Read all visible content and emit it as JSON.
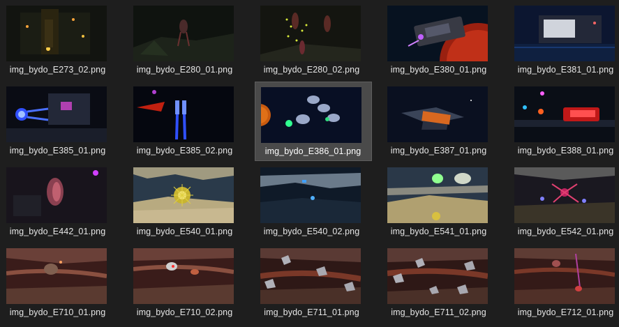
{
  "selected_file": "img_bydo_E386_01.png",
  "files": [
    {
      "name": "img_bydo_E273_02.png",
      "scene": "dark-hive"
    },
    {
      "name": "img_bydo_E280_01.png",
      "scene": "jungle-dark"
    },
    {
      "name": "img_bydo_E280_02.png",
      "scene": "jungle-lights"
    },
    {
      "name": "img_bydo_E380_01.png",
      "scene": "space-ship-planet"
    },
    {
      "name": "img_bydo_E381_01.png",
      "scene": "blue-station"
    },
    {
      "name": "img_bydo_E385_01.png",
      "scene": "station-blue-thrust"
    },
    {
      "name": "img_bydo_E385_02.png",
      "scene": "space-blue-thrust"
    },
    {
      "name": "img_bydo_E386_01.png",
      "scene": "space-pods"
    },
    {
      "name": "img_bydo_E387_01.png",
      "scene": "orange-block"
    },
    {
      "name": "img_bydo_E388_01.png",
      "scene": "red-fighter"
    },
    {
      "name": "img_bydo_E442_01.png",
      "scene": "organic-cave"
    },
    {
      "name": "img_bydo_E540_01.png",
      "scene": "sand-cave-urchin"
    },
    {
      "name": "img_bydo_E540_02.png",
      "scene": "blue-cave"
    },
    {
      "name": "img_bydo_E541_01.png",
      "scene": "sand-cave-green"
    },
    {
      "name": "img_bydo_E542_01.png",
      "scene": "cave-crab"
    },
    {
      "name": "img_bydo_E710_01.png",
      "scene": "flesh-cave-a"
    },
    {
      "name": "img_bydo_E710_02.png",
      "scene": "flesh-cave-b"
    },
    {
      "name": "img_bydo_E711_01.png",
      "scene": "flesh-rocks-a"
    },
    {
      "name": "img_bydo_E711_02.png",
      "scene": "flesh-rocks-b"
    },
    {
      "name": "img_bydo_E712_01.png",
      "scene": "flesh-cave-c"
    }
  ]
}
